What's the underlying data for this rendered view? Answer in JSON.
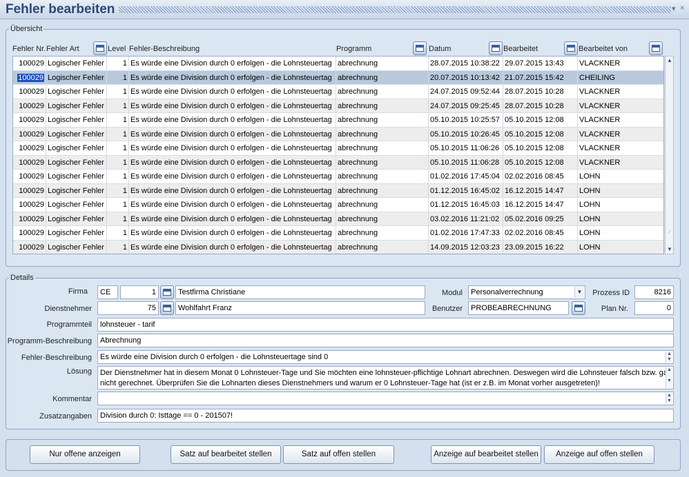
{
  "window": {
    "title": "Fehler bearbeiten"
  },
  "overview": {
    "legend": "Übersicht",
    "columns": [
      "Fehler Nr.",
      "Fehler Art",
      "Level",
      "Fehler-Beschreibung",
      "Programm",
      "Datum",
      "Bearbeitet",
      "Bearbeitet von"
    ],
    "rows": [
      [
        "100029",
        "Logischer Fehler",
        "1",
        "Es würde eine Division durch 0 erfolgen - die Lohnsteuertag",
        "abrechnung",
        "28.07.2015 10:38:22",
        "29.07.2015 13:43",
        "VLACKNER"
      ],
      [
        "100029",
        "Logischer Fehler",
        "1",
        "Es würde eine Division durch 0 erfolgen - die Lohnsteuertag",
        "abrechnung",
        "20.07.2015 10:13:42",
        "21.07.2015 15:42",
        "CHEILING"
      ],
      [
        "100029",
        "Logischer Fehler",
        "1",
        "Es würde eine Division durch 0 erfolgen - die Lohnsteuertag",
        "abrechnung",
        "24.07.2015 09:52:44",
        "28.07.2015 10:28",
        "VLACKNER"
      ],
      [
        "100029",
        "Logischer Fehler",
        "1",
        "Es würde eine Division durch 0 erfolgen - die Lohnsteuertag",
        "abrechnung",
        "24.07.2015 09:25:45",
        "28.07.2015 10:28",
        "VLACKNER"
      ],
      [
        "100029",
        "Logischer Fehler",
        "1",
        "Es würde eine Division durch 0 erfolgen - die Lohnsteuertag",
        "abrechnung",
        "05.10.2015 10:25:57",
        "05.10.2015 12:08",
        "VLACKNER"
      ],
      [
        "100029",
        "Logischer Fehler",
        "1",
        "Es würde eine Division durch 0 erfolgen - die Lohnsteuertag",
        "abrechnung",
        "05.10.2015 10:26:45",
        "05.10.2015 12:08",
        "VLACKNER"
      ],
      [
        "100029",
        "Logischer Fehler",
        "1",
        "Es würde eine Division durch 0 erfolgen - die Lohnsteuertag",
        "abrechnung",
        "05.10.2015 11:06:26",
        "05.10.2015 12:08",
        "VLACKNER"
      ],
      [
        "100029",
        "Logischer Fehler",
        "1",
        "Es würde eine Division durch 0 erfolgen - die Lohnsteuertag",
        "abrechnung",
        "05.10.2015 11:06:28",
        "05.10.2015 12:08",
        "VLACKNER"
      ],
      [
        "100029",
        "Logischer Fehler",
        "1",
        "Es würde eine Division durch 0 erfolgen - die Lohnsteuertag",
        "abrechnung",
        "01.02.2016 17:45:04",
        "02.02.2016 08:45",
        "LOHN"
      ],
      [
        "100029",
        "Logischer Fehler",
        "1",
        "Es würde eine Division durch 0 erfolgen - die Lohnsteuertag",
        "abrechnung",
        "01.12.2015 16:45:02",
        "16.12.2015 14:47",
        "LOHN"
      ],
      [
        "100029",
        "Logischer Fehler",
        "1",
        "Es würde eine Division durch 0 erfolgen - die Lohnsteuertag",
        "abrechnung",
        "01.12.2015 16:45:03",
        "16.12.2015 14:47",
        "LOHN"
      ],
      [
        "100029",
        "Logischer Fehler",
        "1",
        "Es würde eine Division durch 0 erfolgen - die Lohnsteuertag",
        "abrechnung",
        "03.02.2016 11:21:02",
        "05.02.2016 09:25",
        "LOHN"
      ],
      [
        "100029",
        "Logischer Fehler",
        "1",
        "Es würde eine Division durch 0 erfolgen - die Lohnsteuertag",
        "abrechnung",
        "01.02.2016 17:47:33",
        "02.02.2016 08:45",
        "LOHN"
      ],
      [
        "100029",
        "Logischer Fehler",
        "1",
        "Es würde eine Division durch 0 erfolgen - die Lohnsteuertag",
        "abrechnung",
        "14.09.2015 12:03:23",
        "23.09.2015 16:22",
        "LOHN"
      ]
    ]
  },
  "details": {
    "legend": "Details",
    "firma_label": "Firma",
    "firma_code": "CE",
    "firma_nr": "1",
    "firma_name": "Testfirma Christiane",
    "modul_label": "Modul",
    "modul_value": "Personalverrechnung",
    "prozess_label": "Prozess ID",
    "prozess_value": "8216",
    "dn_label": "Dienstnehmer",
    "dn_nr": "75",
    "dn_name": "Wohlfahrt Franz",
    "benutzer_label": "Benutzer",
    "benutzer_value": "PROBEABRECHNUNG",
    "plan_label": "Plan Nr.",
    "plan_value": "0",
    "programmteil_label": "Programmteil",
    "programmteil_value": "lohnsteuer - tarif",
    "progbeschr_label": "Programm-Beschreibung",
    "progbeschr_value": "Abrechnung",
    "fehlerbeschr_label": "Fehler-Beschreibung",
    "fehlerbeschr_value": "Es würde eine Division durch 0 erfolgen - die Lohnsteuertage sind 0",
    "loesung_label": "Lösung",
    "loesung_value": "Der Dienstnehmer hat in diesem Monat 0 Lohnsteuer-Tage und Sie möchten eine lohnsteuer-pflichtige Lohnart abrechnen. Deswegen wird die Lohnsteuer falsch bzw. gar nicht gerechnet. Überprüfen Sie die Lohnarten dieses Dienstnehmers und warum er 0 Lohnsteuer-Tage hat (ist er z.B. im Monat vorher ausgetreten)!",
    "kommentar_label": "Kommentar",
    "kommentar_value": "",
    "zusatz_label": "Zusatzangaben",
    "zusatz_value": "Division durch 0: Isttage == 0 - 201507!"
  },
  "buttons": {
    "nur_offene": "Nur offene anzeigen",
    "satz_bearbeitet": "Satz auf bearbeitet stellen",
    "satz_offen": "Satz auf offen stellen",
    "anzeige_bearbeitet": "Anzeige auf bearbeitet stellen",
    "anzeige_offen": "Anzeige auf offen stellen"
  },
  "colors": {
    "selected_row": "#b9c9dd",
    "highlight": "#1c4fc3",
    "title": "#2b4a78"
  }
}
